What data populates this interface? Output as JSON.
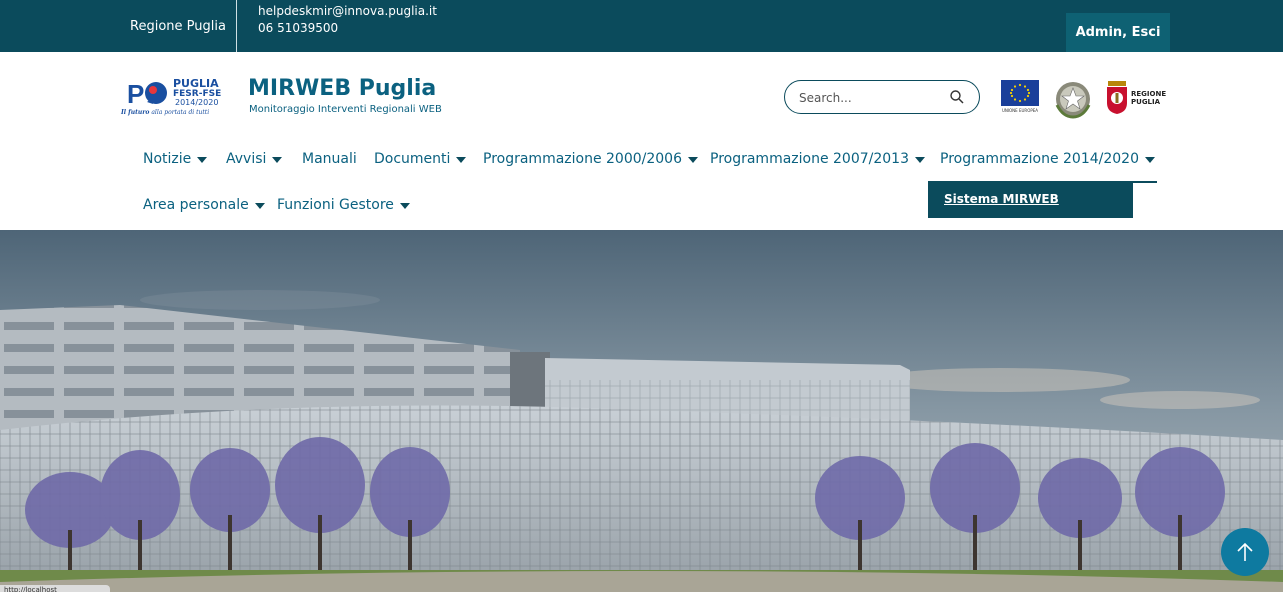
{
  "topbar": {
    "region": "Regione Puglia",
    "email": "helpdeskmir@innova.puglia.it",
    "phone": "06 51039500",
    "user_action": "Admin, Esci"
  },
  "header": {
    "por_logo": {
      "top": "PUGLIA",
      "mid": "FESR-FSE",
      "years": "2014/2020",
      "tagline_bold": "Il futuro",
      "tagline_rest": "alla portata di tutti"
    },
    "title": "MIRWEB Puglia",
    "subtitle": "Monitoraggio Interventi Regionali WEB",
    "search_placeholder": "Search...",
    "eu_logo_text": "UNIONE EUROPEA",
    "puglia_logo_line1": "REGIONE",
    "puglia_logo_line2": "PUGLIA"
  },
  "nav": {
    "items": [
      {
        "label": "Notizie",
        "has_caret": true
      },
      {
        "label": "Avvisi",
        "has_caret": true
      },
      {
        "label": "Manuali",
        "has_caret": false
      },
      {
        "label": "Documenti",
        "has_caret": true
      },
      {
        "label": "Programmazione 2000/2006",
        "has_caret": true
      },
      {
        "label": "Programmazione 2007/2013",
        "has_caret": true
      },
      {
        "label": "Programmazione 2014/2020",
        "has_caret": true
      },
      {
        "label": "Area personale",
        "has_caret": true
      },
      {
        "label": "Funzioni Gestore",
        "has_caret": true
      }
    ],
    "dropdown_item": "Sistema MIRWEB"
  },
  "status": {
    "url_tooltip": "http://localhost"
  },
  "icons": {
    "search": "search-icon",
    "caret": "caret-down-icon",
    "scroll_top": "arrow-up-icon"
  },
  "colors": {
    "topbar": "#0b4b5c",
    "accent": "#0b6180",
    "scroll_button": "#0e7aa0"
  }
}
